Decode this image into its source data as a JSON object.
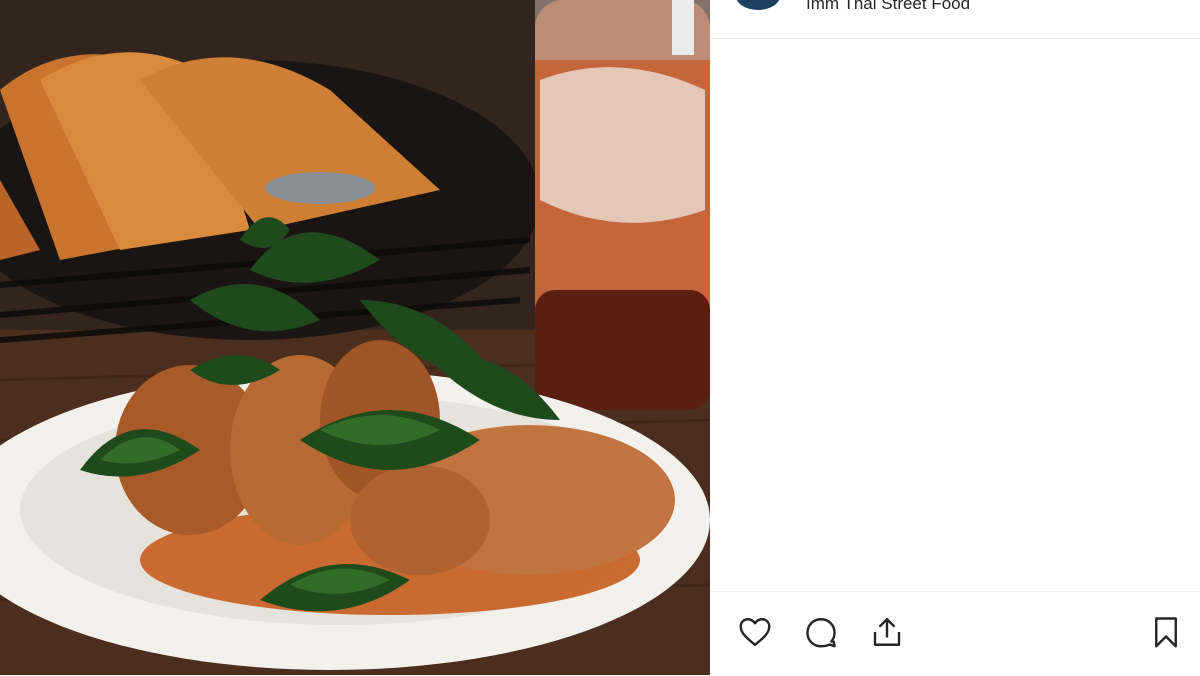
{
  "post": {
    "account_name": "Imm Thai Street Food",
    "photo_alt": "Fried chicken wings topped with crispy basil leaves on a white plate, with a basket and a glass of Thai iced tea in the background"
  },
  "actions": {
    "like_icon": "heart-icon",
    "comment_icon": "comment-bubble-icon",
    "share_icon": "share-upload-icon",
    "save_icon": "bookmark-icon"
  },
  "colors": {
    "avatar": "#1e3f5f",
    "divider": "#efefef",
    "icon": "#262626"
  }
}
